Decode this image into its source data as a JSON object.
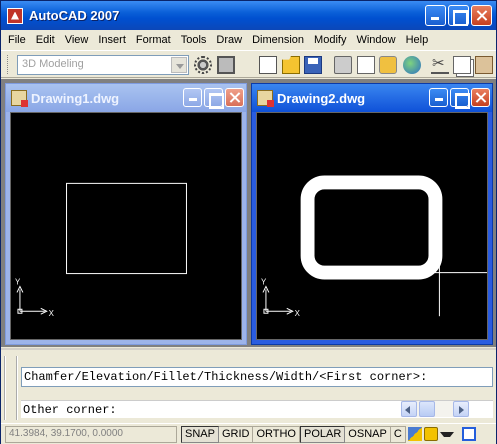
{
  "app": {
    "title": "AutoCAD 2007"
  },
  "menu": [
    "File",
    "Edit",
    "View",
    "Insert",
    "Format",
    "Tools",
    "Draw",
    "Dimension",
    "Modify",
    "Window",
    "Help"
  ],
  "toolbar": {
    "workspace": "3D Modeling",
    "icons": [
      "workspace-settings-icon",
      "pick-icon",
      "new-icon",
      "open-icon",
      "save-icon",
      "plot-icon",
      "plot-preview-icon",
      "publish-icon",
      "web-icon",
      "cut-icon",
      "copy-icon",
      "paste-icon"
    ]
  },
  "drawings": [
    {
      "name": "Drawing1.dwg",
      "active": false,
      "ucs_x": "X",
      "ucs_y": "Y"
    },
    {
      "name": "Drawing2.dwg",
      "active": true,
      "ucs_x": "X",
      "ucs_y": "Y"
    }
  ],
  "command": {
    "history": "Chamfer/Elevation/Fillet/Thickness/Width/<First corner>:",
    "prompt": "Other corner:"
  },
  "status": {
    "coordinates": "41.3984, 39.1700, 0.0000",
    "modes": [
      {
        "label": "SNAP",
        "on": true
      },
      {
        "label": "GRID",
        "on": false
      },
      {
        "label": "ORTHO",
        "on": false
      },
      {
        "label": "POLAR",
        "on": true
      },
      {
        "label": "OSNAP",
        "on": false
      },
      {
        "label": "C",
        "on": false
      }
    ]
  },
  "colors": {
    "title_active": "#0a5fd8",
    "title_inactive": "#9db4ea",
    "canvas": "#000000",
    "drawing": "#ffffff"
  }
}
